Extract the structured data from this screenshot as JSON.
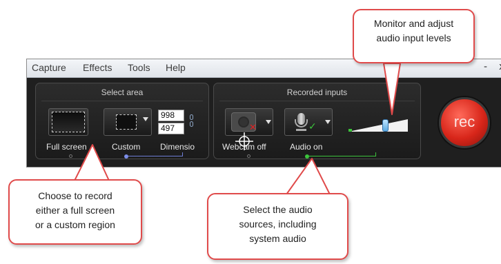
{
  "menu": {
    "items": [
      "Capture",
      "Effects",
      "Tools",
      "Help"
    ],
    "minimize_glyph": "-",
    "close_glyph": "x"
  },
  "select_area": {
    "title": "Select area",
    "full_screen_label": "Full screen",
    "custom_label": "Custom",
    "dimensions_label": "Dimensio",
    "width_value": "998",
    "height_value": "497"
  },
  "recorded_inputs": {
    "title": "Recorded inputs",
    "webcam_label": "Webcam off",
    "audio_label": "Audio on"
  },
  "rec_button": {
    "label": "rec"
  },
  "callouts": {
    "audio_levels": [
      "Monitor and adjust",
      "audio input levels"
    ],
    "area": [
      "Choose to record",
      "either a full screen",
      "or a custom region"
    ],
    "audio_sources": [
      "Select the audio",
      "sources, including",
      "system audio"
    ]
  },
  "colors": {
    "callout_border": "#e04a4a",
    "rec_red": "#d8261a",
    "level_green": "#3cc43c"
  }
}
